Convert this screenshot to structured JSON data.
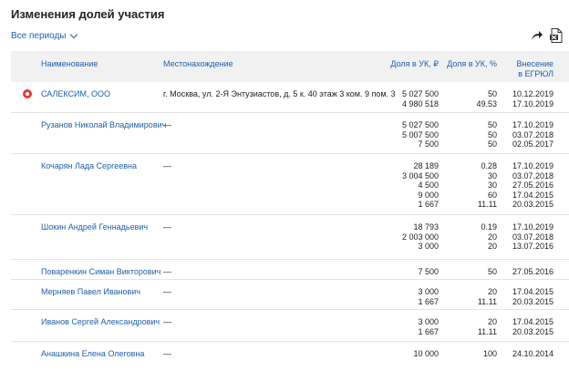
{
  "title": "Изменения долей участия",
  "period_filter": "Все периоды",
  "icons": {
    "share": "share-arrow-icon",
    "excel": "excel-export-icon"
  },
  "columns": {
    "name": "Наименование",
    "location": "Местонахождение",
    "share": "Доля в УК, ₽",
    "percent": "Доля в УК, %",
    "date_line1": "Внесение",
    "date_line2": "в ЕГРЮЛ"
  },
  "rows": [
    {
      "name": "САЛЕКСИМ, ООО",
      "location": "г. Москва, ул. 2-Я Энтузиастов, д. 5 к. 40 этаж 3 ком. 9 пом. 3",
      "marker": true,
      "entries": [
        {
          "share": "5 027 500",
          "percent": "50",
          "date": "10.12.2019"
        },
        {
          "share": "4 980 518",
          "percent": "49.53",
          "date": "17.10.2019"
        }
      ]
    },
    {
      "name": "Рузанов Николай Владимирович",
      "location": "—",
      "marker": false,
      "entries": [
        {
          "share": "5 027 500",
          "percent": "50",
          "date": "17.10.2019"
        },
        {
          "share": "5 007 500",
          "percent": "50",
          "date": "03.07.2018"
        },
        {
          "share": "7 500",
          "percent": "50",
          "date": "02.05.2017"
        }
      ]
    },
    {
      "name": "Кочарян Лада Сергеевна",
      "location": "—",
      "marker": false,
      "entries": [
        {
          "share": "28 189",
          "percent": "0.28",
          "date": "17.10.2019"
        },
        {
          "share": "3 004 500",
          "percent": "30",
          "date": "03.07.2018"
        },
        {
          "share": "4 500",
          "percent": "30",
          "date": "27.05.2016"
        },
        {
          "share": "9 000",
          "percent": "60",
          "date": "17.04.2015"
        },
        {
          "share": "1 667",
          "percent": "11.11",
          "date": "20.03.2015"
        }
      ]
    },
    {
      "name": "Шокин Андрей Геннадьевич",
      "location": "—",
      "marker": false,
      "entries": [
        {
          "share": "18 793",
          "percent": "0.19",
          "date": "17.10.2019"
        },
        {
          "share": "2 003 000",
          "percent": "20",
          "date": "03.07.2018"
        },
        {
          "share": "3 000",
          "percent": "20",
          "date": "13.07.2016"
        }
      ]
    },
    {
      "name": "Поваренкин Симан Викторович",
      "location": "—",
      "marker": false,
      "entries": [
        {
          "share": "7 500",
          "percent": "50",
          "date": "27.05.2016"
        }
      ]
    },
    {
      "name": "Мерняев Павел Иванович",
      "location": "—",
      "marker": false,
      "entries": [
        {
          "share": "3 000",
          "percent": "20",
          "date": "17.04.2015"
        },
        {
          "share": "1 667",
          "percent": "11.11",
          "date": "20.03.2015"
        }
      ]
    },
    {
      "name": "Иванов Сергей Александрович",
      "location": "—",
      "marker": false,
      "entries": [
        {
          "share": "3 000",
          "percent": "20",
          "date": "17.04.2015"
        },
        {
          "share": "1 667",
          "percent": "11.11",
          "date": "20.03.2015"
        }
      ]
    },
    {
      "name": "Анашкина Елена Олеговна",
      "location": "—",
      "marker": false,
      "entries": [
        {
          "share": "10 000",
          "percent": "100",
          "date": "24.10.2014"
        }
      ]
    }
  ]
}
